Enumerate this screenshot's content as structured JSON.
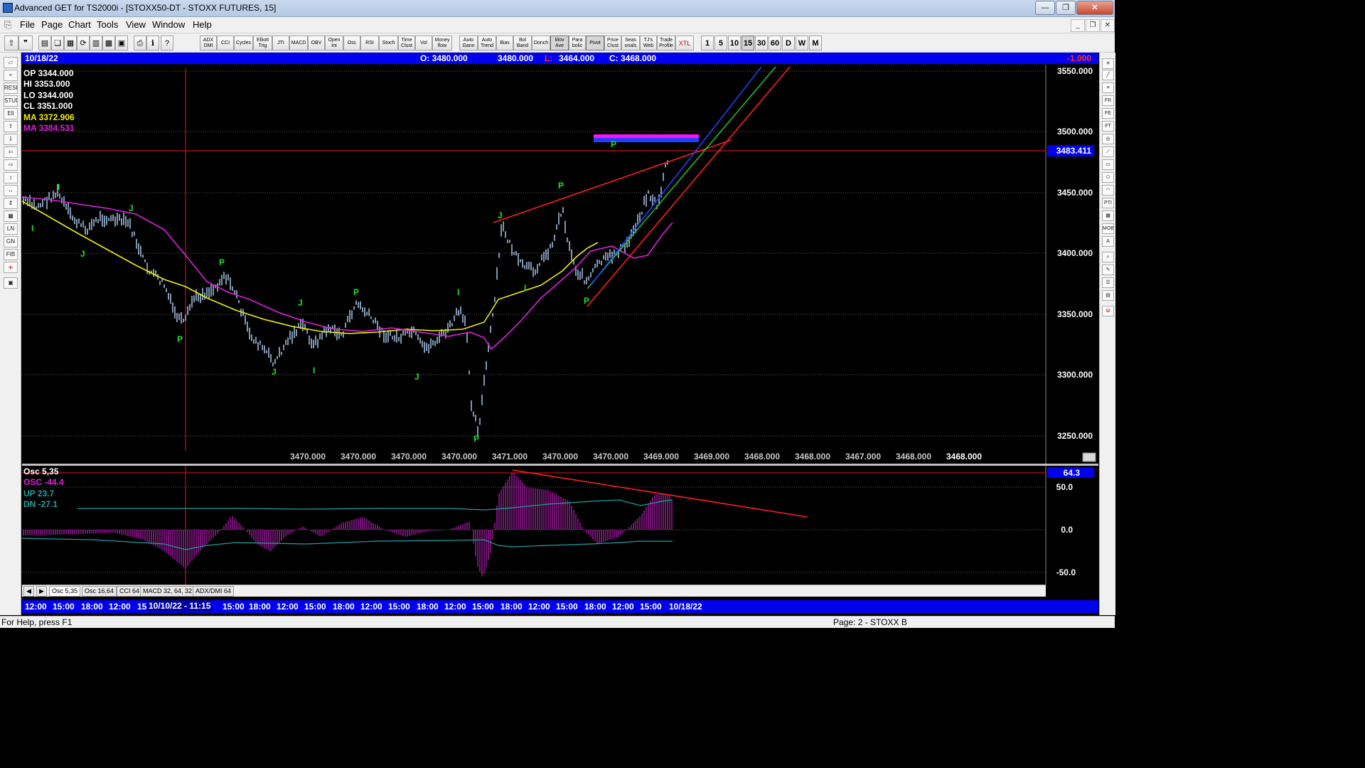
{
  "window": {
    "title": "Advanced GET for TS2000i - [STOXX50-DT - STOXX FUTURES, 15]",
    "buttons": {
      "minimize": "—",
      "restore": "❐",
      "close": "✕"
    }
  },
  "menu": [
    "File",
    "Page",
    "Chart",
    "Tools",
    "View",
    "Window",
    "Help"
  ],
  "toolbar": {
    "indicator_buttons": [
      "ADX DMI",
      "CCI",
      "Cycles",
      "Elliott Trig",
      "JTI",
      "MACD",
      "OBV",
      "Open Int",
      "Osc",
      "RSI",
      "Stoch",
      "Time Clust",
      "Vol",
      "Money flow"
    ],
    "tool_buttons": [
      "Auto Gann",
      "Auto Trend",
      "Bias",
      "Bol Band",
      "Donch",
      "Mov Ave",
      "Para bolic",
      "Pivot",
      "Price Clust",
      "Seas onals",
      "TJ's Web",
      "Trade Profile",
      "XTL"
    ],
    "periods": [
      "1",
      "5",
      "10",
      "15",
      "30",
      "60",
      "D",
      "W",
      "M"
    ],
    "selected_period": "15"
  },
  "header": {
    "date": "10/18/22",
    "open": "O: 3480.000",
    "high": "3480.000",
    "low_label": "L:",
    "low_value": "3464.000",
    "close": "C: 3468.000",
    "change": "-1.000"
  },
  "info_box": {
    "op": "OP  3344.000",
    "hi": "HI   3353.000",
    "lo": "LO  3344.000",
    "cl": "CL   3351.000",
    "ma1": "MA  3372.906",
    "ma2": "MA  3384.531"
  },
  "price_axis": {
    "labels": [
      "3550.000",
      "3500.000",
      "3450.000",
      "3400.000",
      "3350.000",
      "3300.000",
      "3250.000"
    ],
    "current_price": "3483.411"
  },
  "pivot_row": [
    "3470.000",
    "3470.000",
    "3470.000",
    "3470.000",
    "3471.000",
    "3470.000",
    "3470.000",
    "3469.000",
    "3469.000",
    "3468.000",
    "3468.000",
    "3467.000",
    "3468.000",
    "3468.000"
  ],
  "wave_markers": [
    "I",
    "I",
    "J",
    "J",
    "P",
    "P",
    "J",
    "J",
    "P",
    "I",
    "P",
    "J",
    "I",
    "P",
    "J",
    "P",
    "I",
    "P"
  ],
  "oscillator": {
    "title": "Osc 5,35",
    "osc": "OSC -44.4",
    "up": "UP   23.7",
    "dn": "DN   -27.1",
    "axis_labels": [
      "50.0",
      "0.0",
      "-50.0"
    ],
    "current_value": "64.3"
  },
  "tabs": [
    "Osc 5,35",
    "Osc 16,64",
    "CCI 64",
    "MACD 32, 64, 32",
    "ADX/DMI 64"
  ],
  "timebar": [
    "12:00",
    "15:00",
    "18:00",
    "12:00",
    "15",
    "10/10/22 - 11:15",
    "15:00",
    "18:00",
    "12:00",
    "15:00",
    "18:00",
    "12:00",
    "15:00",
    "18:00",
    "12:00",
    "15:00",
    "18:00",
    "12:00",
    "15:00",
    "18:00",
    "12:00",
    "15:00",
    "10/18/22"
  ],
  "status": {
    "help": "For Help, press F1",
    "page": "Page: 2 - STOXX B"
  },
  "colors": {
    "header_blue": "#0000ee",
    "ma_yellow": "#f0f000",
    "ma_magenta": "#e020e0",
    "price_bars": "#a8c8ec",
    "trend_red": "#ff2020"
  }
}
